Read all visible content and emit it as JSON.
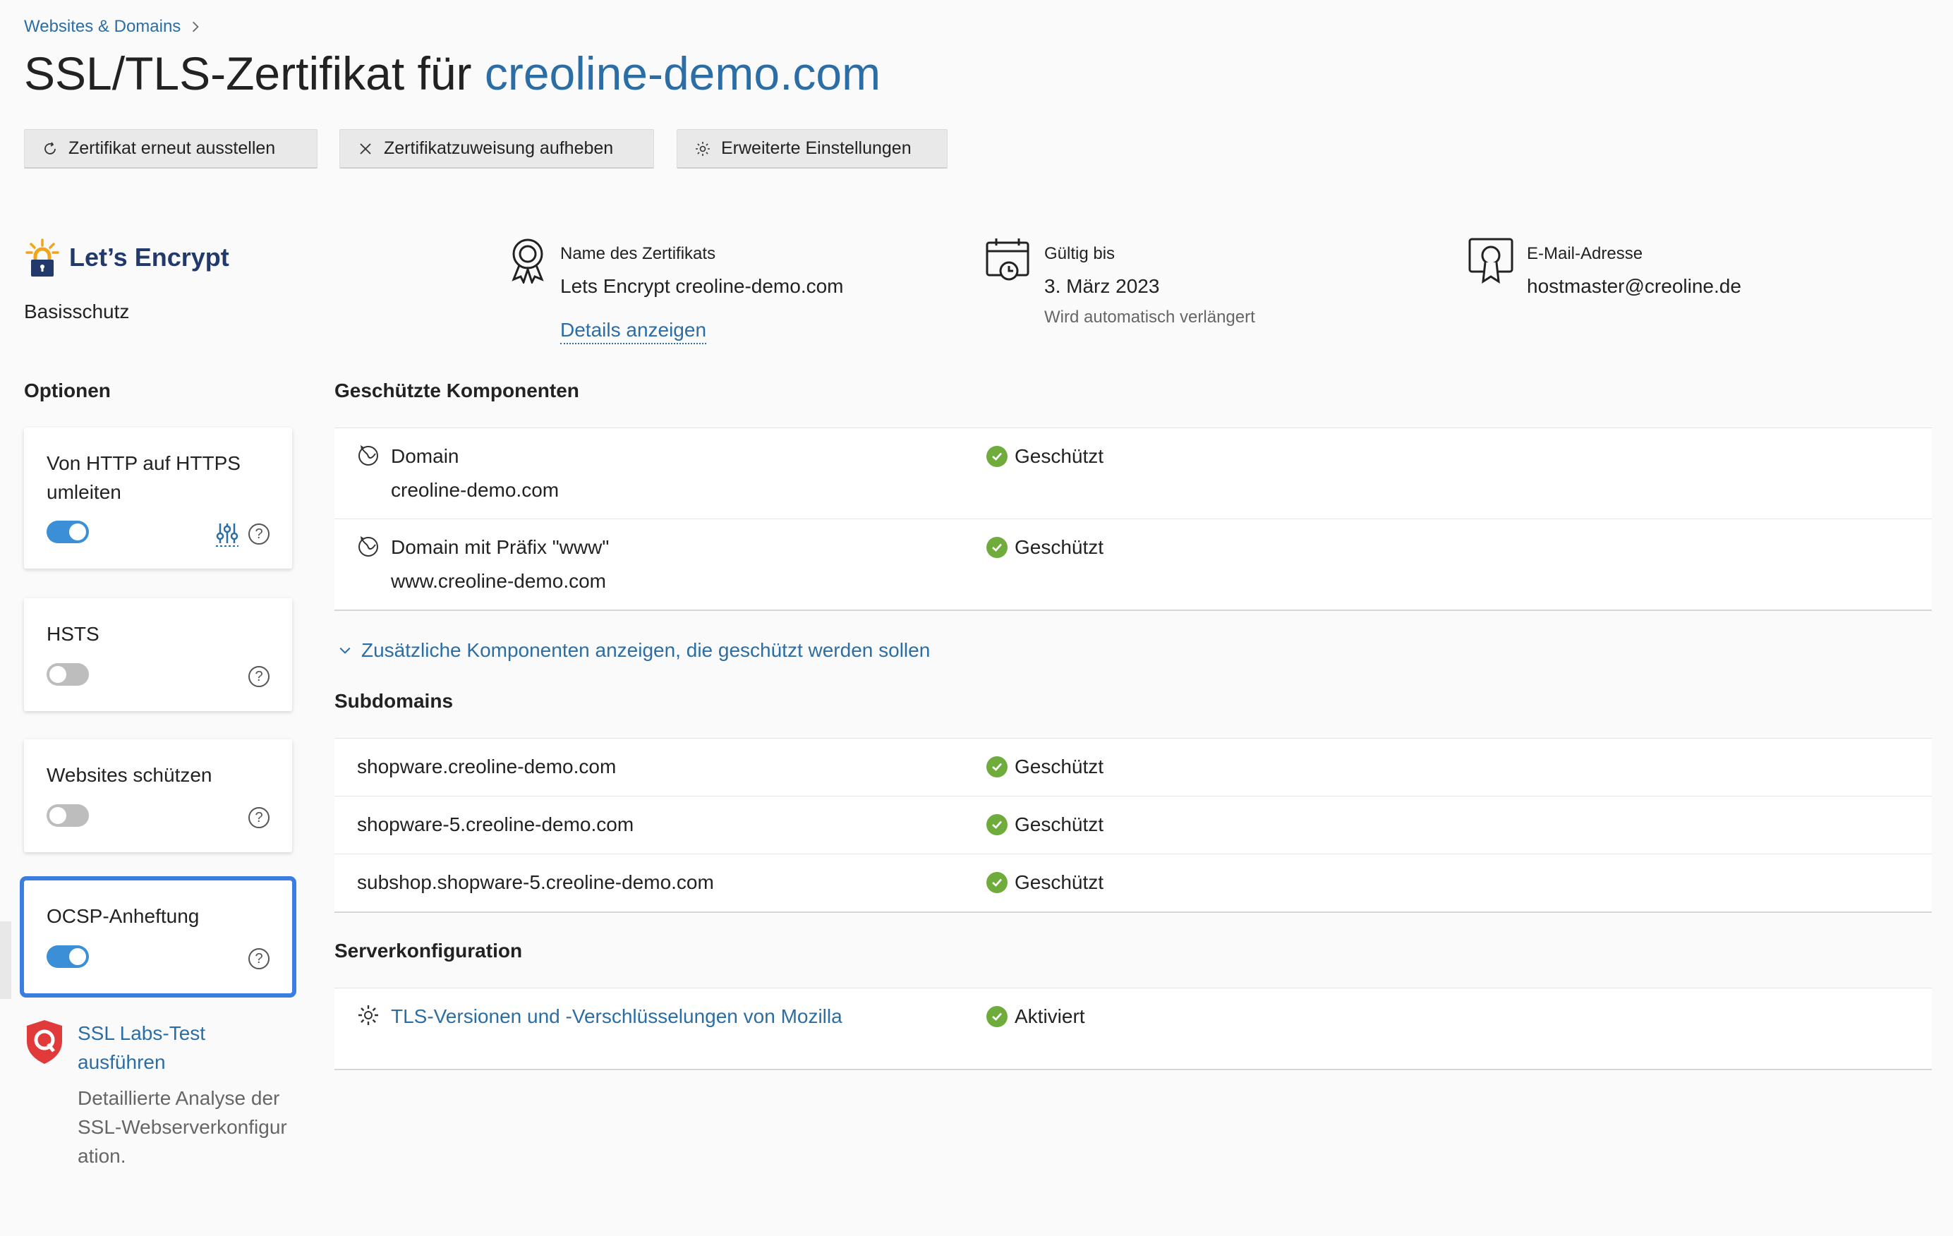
{
  "breadcrumb": {
    "label": "Websites & Domains"
  },
  "header": {
    "title_prefix": "SSL/TLS-Zertifikat für",
    "title_domain": "creoline-demo.com"
  },
  "toolbar": {
    "reissue_label": "Zertifikat erneut ausstellen",
    "unassign_label": "Zertifikatzuweisung aufheben",
    "advanced_label": "Erweiterte Einstellungen"
  },
  "provider": {
    "name": "Let’s Encrypt",
    "plan": "Basisschutz"
  },
  "cert_info": {
    "name_label": "Name des Zertifikats",
    "name_value": "Lets Encrypt creoline-demo.com",
    "details_link": "Details anzeigen",
    "valid_label": "Gültig bis",
    "valid_value": "3. März 2023",
    "valid_sub": "Wird automatisch verlängert",
    "email_label": "E-Mail-Adresse",
    "email_value": "hostmaster@creoline.de"
  },
  "options": {
    "heading": "Optionen",
    "items": [
      {
        "label": "Von HTTP auf HTTPS umleiten",
        "enabled": true
      },
      {
        "label": "HSTS",
        "enabled": false
      },
      {
        "label": "Websites schützen",
        "enabled": false
      },
      {
        "label": "OCSP-Anheftung",
        "enabled": true
      }
    ]
  },
  "ssllabs": {
    "link": "SSL Labs-Test ausführen",
    "desc": "Detaillierte Analyse der SSL-Webserverkonfiguration."
  },
  "components": {
    "heading": "Geschützte Komponenten",
    "rows": [
      {
        "title": "Domain",
        "value": "creoline-demo.com",
        "status": "Geschützt"
      },
      {
        "title": "Domain mit Präfix \"www\"",
        "value": "www.creoline-demo.com",
        "status": "Geschützt"
      }
    ],
    "more_link": "Zusätzliche Komponenten anzeigen, die geschützt werden sollen"
  },
  "subdomains": {
    "heading": "Subdomains",
    "rows": [
      {
        "name": "shopware.creoline-demo.com",
        "status": "Geschützt"
      },
      {
        "name": "shopware-5.creoline-demo.com",
        "status": "Geschützt"
      },
      {
        "name": "subshop.shopware-5.creoline-demo.com",
        "status": "Geschützt"
      }
    ]
  },
  "server": {
    "heading": "Serverkonfiguration",
    "rows": [
      {
        "name": "TLS-Versionen und -Verschlüsselungen von Mozilla",
        "status": "Aktiviert"
      }
    ]
  },
  "colors": {
    "accent": "#2b6ea6",
    "success": "#6fac3c",
    "highlight": "#3a7ee4",
    "toggle_on": "#3a8fd6"
  }
}
